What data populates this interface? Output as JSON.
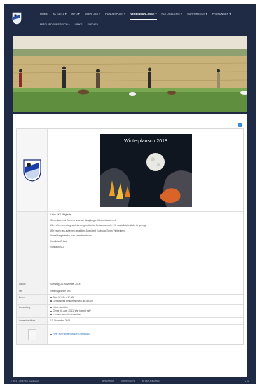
{
  "header": {
    "nav_row1": [
      "HOME",
      "AKTUELL ▾",
      "INFO ▾",
      "ÜBER UNS ▾",
      "HUNDESPORT ▾",
      "VEREINSANLÄSSE ▾",
      "FOTOGALERIE ▾",
      "SURFBREEDS ▾",
      "PRÜFUNGEN ▾"
    ],
    "nav_row2": [
      "MITGLIEDERBEREICH ▾",
      "LINKS",
      "SUCHEN"
    ],
    "active_index": 5
  },
  "event": {
    "image_title": "Winterplausch 2018",
    "rows": {
      "details_lines": [
        "Liebe SKG-Mitglieder",
        "Gerne laden wir Euch zu unserem diesjährigen Winterplausch ein!",
        "Wir treffen uns wie gewohnt zum gemütlichen Beisammensein. Für das leibliche Wohl ist gesorgt.",
        "Wir freuen uns auf einen geselligen Abend mit Euch und Euren Vierbeinern.",
        "Anmeldung bitte bis zum Anmeldeschluss.",
        "Herzliche Grüsse",
        "Vorstand SKG"
      ],
      "datum_label": "Datum",
      "datum_value": "Samstag, 24. November 2018",
      "ort_label": "Ort",
      "ort_value": "Vereinsgelände SKG",
      "zeiten_label": "Zeiten",
      "zeiten_items": [
        "Start 17:00h – 17:30h",
        "Gemütliches Beisammensein ab 18:00h"
      ],
      "anmeldung_label": "Anmeldung",
      "anmeldung_items": [
        "Keine Schleifer",
        "Gerne bis zum 13.11. Wer kommt mit?",
        "...Inform. zum Vereinsanlass"
      ],
      "schluss_label": "Anmeldeschluss",
      "schluss_value": "13. November 2018",
      "attachment_text": "Flyer zum Winterplausch (Download)"
    }
  },
  "footer": {
    "copy": "© 2013 – 2018 SKG Hundesport",
    "links": [
      "IMPRESSUM",
      "DATENSCHUTZ",
      "ZU DEN ANLÄSSEN"
    ],
    "top": "▲ top"
  },
  "colors": {
    "header_bg": "#1f2a44",
    "accent": "#3a8fd6"
  }
}
